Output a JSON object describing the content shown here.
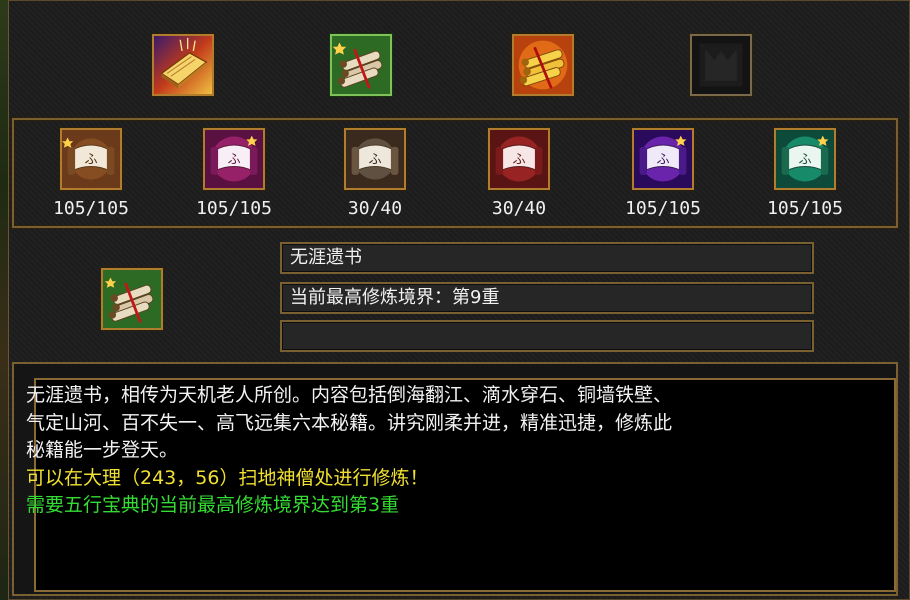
{
  "top_slots": [
    {
      "icon": "golden-book-icon"
    },
    {
      "icon": "scroll-bundle-icon",
      "selected": true
    },
    {
      "icon": "golden-scroll-bundle-icon"
    },
    {
      "icon": "empty-slot-icon"
    }
  ],
  "skills": [
    {
      "icon": "bronze-scroll-icon",
      "count": "105/105"
    },
    {
      "icon": "magenta-scroll-icon",
      "count": "105/105"
    },
    {
      "icon": "silver-scroll-icon",
      "count": "30/40"
    },
    {
      "icon": "red-scroll-icon",
      "count": "30/40"
    },
    {
      "icon": "purple-scroll-icon",
      "count": "105/105"
    },
    {
      "icon": "teal-scroll-icon",
      "count": "105/105"
    }
  ],
  "detail": {
    "icon": "scroll-bundle-icon",
    "name": "无涯遗书",
    "level_text": "当前最高修炼境界：第9重",
    "extra": ""
  },
  "description": {
    "lines": [
      "无涯遗书，相传为天机老人所创。内容包括倒海翻江、滴水穿石、铜墙铁壁、",
      "气定山河、百不失一、高飞远集六本秘籍。讲究刚柔并进，精准迅捷，修炼此",
      "秘籍能一步登天。"
    ],
    "location_hint": "可以在大理（243，56）扫地神僧处进行修炼！",
    "requirement": "需要五行宝典的当前最高修炼境界达到第3重"
  },
  "colors": {
    "location_hint": "#f0e030",
    "requirement": "#33dd33"
  }
}
